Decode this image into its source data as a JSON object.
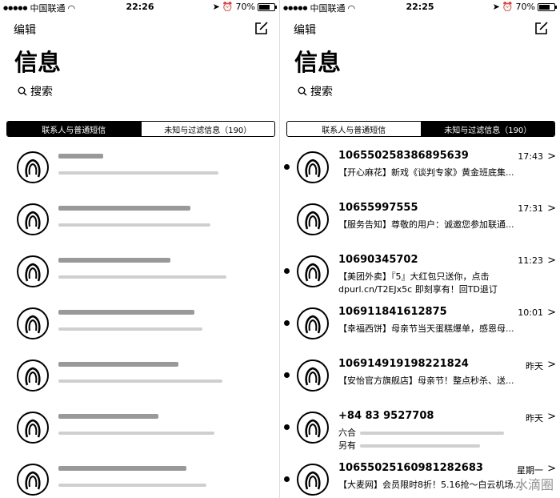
{
  "status": {
    "carrier": "中国联通",
    "battery": "70%",
    "battery_fill": 0.7,
    "left_time": "22:26",
    "right_time": "22:25"
  },
  "nav": {
    "edit_label": "编辑",
    "compose_icon": "compose-icon"
  },
  "title": "信息",
  "search_placeholder": "搜索",
  "tabs": {
    "contacts": "联系人与普通短信",
    "unknown": "未知与过滤信息（190）"
  },
  "messages": [
    {
      "sender": "106550258386895639",
      "time": "17:43",
      "preview": "【开心麻花】新戏《谈判专家》黄金班底集..."
    },
    {
      "sender": "10655997555",
      "time": "17:31",
      "preview": "【服务告知】尊敬的用户：诚邀您参加联通..."
    },
    {
      "sender": "10690345702",
      "time": "11:23",
      "preview": "【美团外卖】『5』大红包只送你，点击\ndpurl.cn/T2EJx5c 即刻享有！回TD退订"
    },
    {
      "sender": "106911841612875",
      "time": "10:01",
      "preview": "【幸福西饼】母亲节当天蛋糕爆单，感恩母..."
    },
    {
      "sender": "106914919198221824",
      "time": "昨天",
      "preview": "【安怡官方旗舰店】母亲节！整点秒杀、送..."
    },
    {
      "sender": "+84 83 9527708",
      "time": "昨天",
      "preview": "六合\n另有"
    },
    {
      "sender": "10655025160981282683",
      "time": "星期一",
      "preview": "【大麦网】会员限时8折！5.16抢～白云机场..."
    }
  ],
  "watermark": "水滴圈"
}
